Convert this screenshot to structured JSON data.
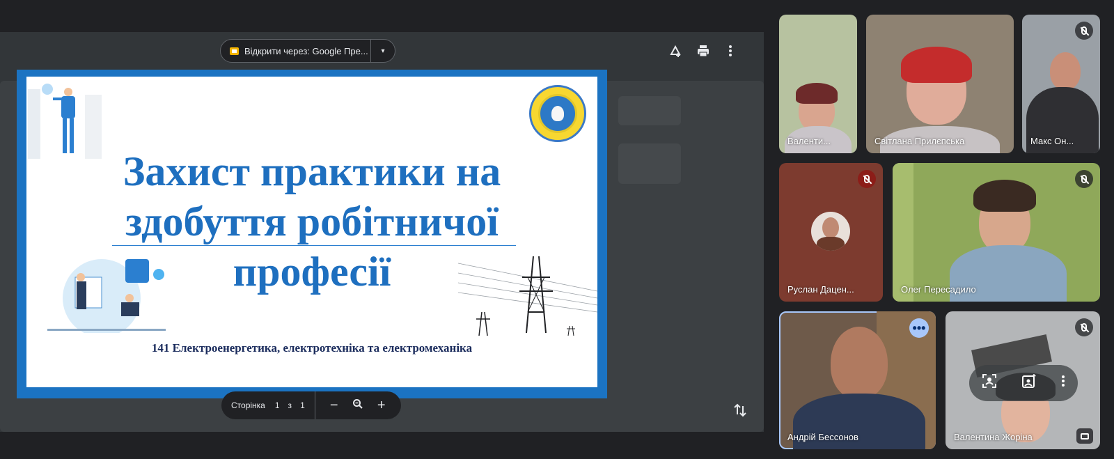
{
  "viewer": {
    "open_with_label": "Відкрити через: Google Пре...",
    "caret": "▾",
    "icons": [
      "add-to-drive-icon",
      "print-icon",
      "more-vert-icon"
    ]
  },
  "slide": {
    "title_lines": [
      "Захист практики на",
      "здобуття робітничої",
      "професії"
    ],
    "subtitle": "141 Електроенергетика, електротехніка та електромеханіка"
  },
  "pager": {
    "label": "Сторінка",
    "current": "1",
    "separator": "з",
    "total": "1",
    "zoom_out": "−",
    "zoom_in": "+"
  },
  "participants": [
    {
      "name": "Валенти...",
      "muted": false
    },
    {
      "name": "Світлана Прилєпська",
      "muted": false
    },
    {
      "name": "Макс Он...",
      "muted": true
    },
    {
      "name": "Руслан Даце​н...",
      "muted": true
    },
    {
      "name": "Олег Пересадило",
      "muted": true
    },
    {
      "name": "Андрій Бессонов",
      "muted": false
    },
    {
      "name": "Валентина Жоріна",
      "muted": true
    }
  ],
  "colors": {
    "slide_frame": "#1b73c2",
    "title_blue": "#1e6fbf",
    "active_outline": "#a8c7fa"
  }
}
